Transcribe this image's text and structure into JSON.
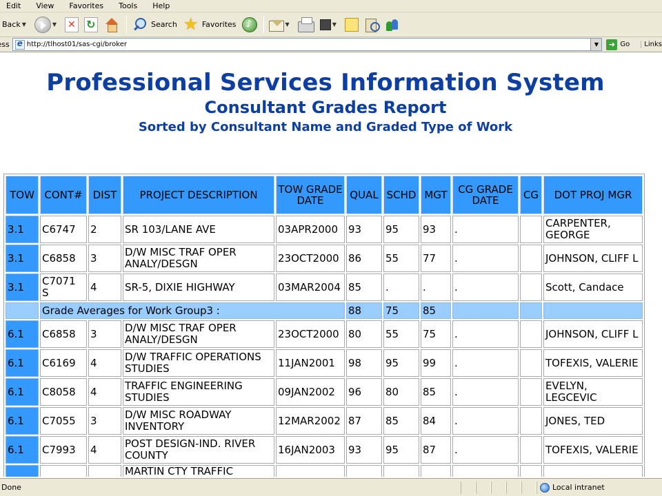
{
  "menu": {
    "items": [
      "Edit",
      "View",
      "Favorites",
      "Tools",
      "Help"
    ]
  },
  "toolbar": {
    "back_label": "Back",
    "search_label": "Search",
    "favorites_label": "Favorites"
  },
  "address": {
    "label": "Address",
    "url": "http://tlhost01/sas-cgi/broker",
    "go_label": "Go",
    "links_label": "Links"
  },
  "page": {
    "title": "Professional Services Information System",
    "subtitle": "Consultant Grades Report",
    "sort_note": "Sorted by Consultant Name and Graded Type of Work"
  },
  "table": {
    "headers": {
      "tow": "TOW",
      "cont": "CONT#",
      "dist": "DIST",
      "desc": "PROJECT DESCRIPTION",
      "tow_date": "TOW GRADE DATE",
      "qual": "QUAL",
      "schd": "SCHD",
      "mgt": "MGT",
      "cg_date": "CG GRADE DATE",
      "cg": "CG",
      "mgr": "DOT PROJ MGR"
    },
    "rows": [
      {
        "tow": "3.1",
        "cont": "C6747",
        "dist": "2",
        "desc": "SR 103/LANE AVE",
        "date": "03APR2000",
        "qual": "93",
        "schd": "95",
        "mgt": "93",
        "cgdate": ".",
        "cg": "",
        "mgr": "CARPENTER, GEORGE"
      },
      {
        "tow": "3.1",
        "cont": "C6858",
        "dist": "3",
        "desc": "D/W MISC TRAF OPER ANALY/DESGN",
        "date": "23OCT2000",
        "qual": "86",
        "schd": "55",
        "mgt": "77",
        "cgdate": ".",
        "cg": "",
        "mgr": "JOHNSON, CLIFF L"
      },
      {
        "tow": "3.1",
        "cont": "C7071 S",
        "dist": "4",
        "desc": "SR-5, DIXIE HIGHWAY",
        "date": "03MAR2004",
        "qual": "85",
        "schd": ".",
        "mgt": ".",
        "cgdate": ".",
        "cg": "",
        "mgr": "Scott, Candace"
      },
      {
        "avg_label": "Grade Averages for Work Group3 :",
        "qual": "88",
        "schd": "75",
        "mgt": "85"
      },
      {
        "tow": "6.1",
        "cont": "C6858",
        "dist": "3",
        "desc": "D/W MISC TRAF OPER ANALY/DESGN",
        "date": "23OCT2000",
        "qual": "80",
        "schd": "55",
        "mgt": "75",
        "cgdate": ".",
        "cg": "",
        "mgr": "JOHNSON, CLIFF L"
      },
      {
        "tow": "6.1",
        "cont": "C6169",
        "dist": "4",
        "desc": "D/W TRAFFIC OPERATIONS STUDIES",
        "date": "11JAN2001",
        "qual": "98",
        "schd": "95",
        "mgt": "99",
        "cgdate": ".",
        "cg": "",
        "mgr": "TOFEXIS, VALERIE"
      },
      {
        "tow": "6.1",
        "cont": "C8058",
        "dist": "4",
        "desc": "TRAFFIC ENGINEERING STUDIES",
        "date": "09JAN2002",
        "qual": "96",
        "schd": "80",
        "mgt": "85",
        "cgdate": ".",
        "cg": "",
        "mgr": "EVELYN, LEGCEVIC"
      },
      {
        "tow": "6.1",
        "cont": "C7055",
        "dist": "3",
        "desc": "D/W MISC ROADWAY INVENTORY",
        "date": "12MAR2002",
        "qual": "87",
        "schd": "85",
        "mgt": "84",
        "cgdate": ".",
        "cg": "",
        "mgr": "JONES, TED"
      },
      {
        "tow": "6.1",
        "cont": "C7993",
        "dist": "4",
        "desc": "POST DESIGN-IND. RIVER COUNTY",
        "date": "16JAN2003",
        "qual": "93",
        "schd": "95",
        "mgt": "87",
        "cgdate": ".",
        "cg": "",
        "mgr": "TOFEXIS, VALERIE"
      },
      {
        "tow": "",
        "cont": "",
        "dist": "",
        "desc": "MARTIN CTY TRAFFIC",
        "date": "",
        "qual": "",
        "schd": "",
        "mgt": "",
        "cgdate": "",
        "cg": "",
        "mgr": ""
      }
    ]
  },
  "status": {
    "text": "Done",
    "zone": "Local intranet"
  },
  "colors": {
    "header_bg": "#3399ff",
    "avg_row_bg": "#99ccff",
    "title_blue": "#0d3ea1"
  }
}
